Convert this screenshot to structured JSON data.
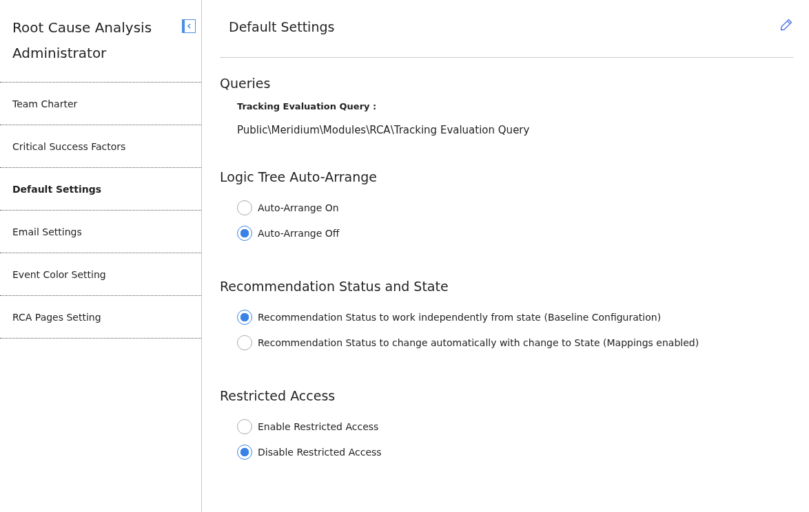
{
  "sidebar": {
    "title": "Root Cause Analysis Administrator",
    "items": [
      {
        "label": "Team Charter",
        "selected": false
      },
      {
        "label": "Critical Success Factors",
        "selected": false
      },
      {
        "label": "Default Settings",
        "selected": true
      },
      {
        "label": "Email Settings",
        "selected": false
      },
      {
        "label": "Event Color Setting",
        "selected": false
      },
      {
        "label": "RCA Pages Setting",
        "selected": false
      }
    ]
  },
  "page": {
    "title": "Default Settings"
  },
  "sections": [
    {
      "kind": "query",
      "heading": "Queries",
      "label": "Tracking Evaluation Query :",
      "value": "Public\\Meridium\\Modules\\RCA\\Tracking Evaluation Query"
    },
    {
      "kind": "radios",
      "heading": "Logic Tree Auto-Arrange",
      "options": [
        {
          "label": "Auto-Arrange On",
          "selected": false
        },
        {
          "label": "Auto-Arrange Off",
          "selected": true
        }
      ]
    },
    {
      "kind": "radios",
      "heading": "Recommendation Status and State",
      "options": [
        {
          "label": "Recommendation Status to work independently from state (Baseline Configuration)",
          "selected": true
        },
        {
          "label": "Recommendation Status to change automatically with change to State (Mappings enabled)",
          "selected": false
        }
      ]
    },
    {
      "kind": "radios",
      "heading": "Restricted Access",
      "options": [
        {
          "label": "Enable Restricted Access",
          "selected": false
        },
        {
          "label": "Disable Restricted Access",
          "selected": true
        }
      ]
    }
  ]
}
